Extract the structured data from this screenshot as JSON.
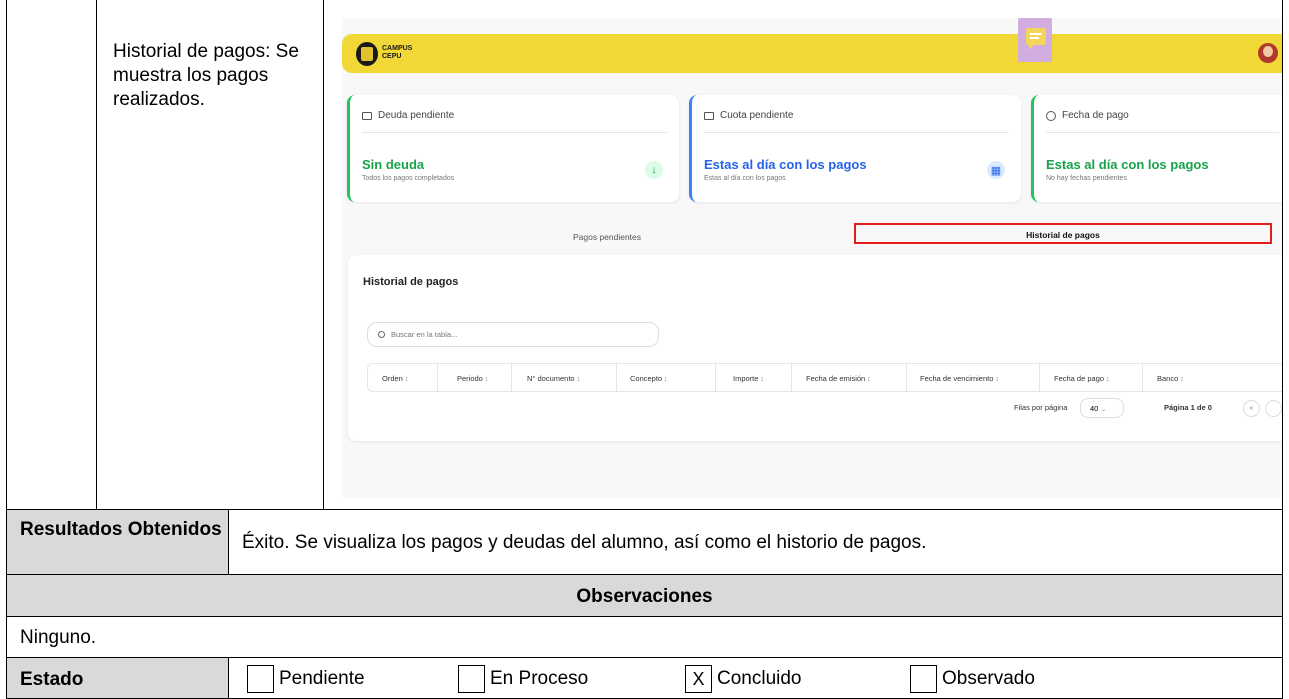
{
  "description": "Historial de pagos: Se muestra los pagos realizados.",
  "app": {
    "brand_line1": "CAMPUS",
    "brand_line2": "CEPU",
    "cards": [
      {
        "header": "Deuda pendiente",
        "title": "Sin deuda",
        "subtitle": "Todos los pagos completados",
        "icon": "arrow-down-icon",
        "color": "#22c55e"
      },
      {
        "header": "Cuota pendiente",
        "title": "Estas al día con los pagos",
        "subtitle": "Estas al día con los pagos",
        "icon": "calendar-icon",
        "color": "#3b82f6"
      },
      {
        "header": "Fecha de pago",
        "title": "Estas al día con los pagos",
        "subtitle": "No hay fechas pendientes",
        "icon": "clock-icon",
        "color": "#22c55e"
      }
    ],
    "tabs": {
      "pending": "Pagos pendientes",
      "history": "Historial de pagos"
    },
    "panel": {
      "title": "Historial de pagos",
      "search_placeholder": "Buscar en la tabla...",
      "columns": [
        "Orden",
        "Periodo",
        "N° documento",
        "Concepto",
        "Importe",
        "Fecha de emisión",
        "Fecha de vencimiento",
        "Fecha de pago",
        "Banco"
      ],
      "rows_per_page_label": "Filas por página",
      "rows_per_page_value": "40",
      "page_label": "Página 1 de 0",
      "first_page_glyph": "«"
    }
  },
  "results": {
    "label": "Resultados Obtenidos",
    "text": "Éxito. Se visualiza los pagos y deudas del alumno, así como el historio de pagos."
  },
  "observations": {
    "heading": "Observaciones",
    "text": "Ninguno."
  },
  "status": {
    "label": "Estado",
    "options": [
      {
        "label": "Pendiente",
        "mark": ""
      },
      {
        "label": "En Proceso",
        "mark": ""
      },
      {
        "label": "Concluido",
        "mark": "X"
      },
      {
        "label": "Observado",
        "mark": ""
      }
    ]
  }
}
